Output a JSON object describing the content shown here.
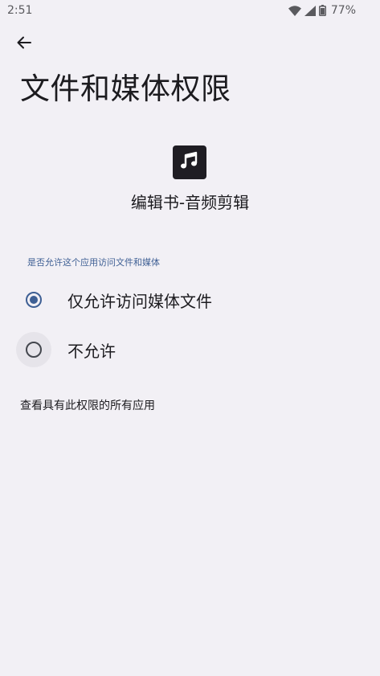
{
  "status_bar": {
    "time": "2:51",
    "battery": "77%",
    "icons": [
      "wifi-icon",
      "signal-icon",
      "battery-icon"
    ]
  },
  "header": {
    "back_icon": "arrow-back-icon",
    "title": "文件和媒体权限"
  },
  "app": {
    "icon": "music-note-icon",
    "name": "编辑书-音频剪辑"
  },
  "permission": {
    "prompt": "是否允许这个应用访问文件和媒体",
    "options": [
      {
        "label": "仅允许访问媒体文件",
        "selected": true
      },
      {
        "label": "不允许",
        "selected": false
      }
    ]
  },
  "footer": {
    "see_all_link": "查看具有此权限的所有应用"
  },
  "colors": {
    "background": "#f2f0f5",
    "accent": "#3e5f94",
    "text": "#1c1b1f"
  }
}
